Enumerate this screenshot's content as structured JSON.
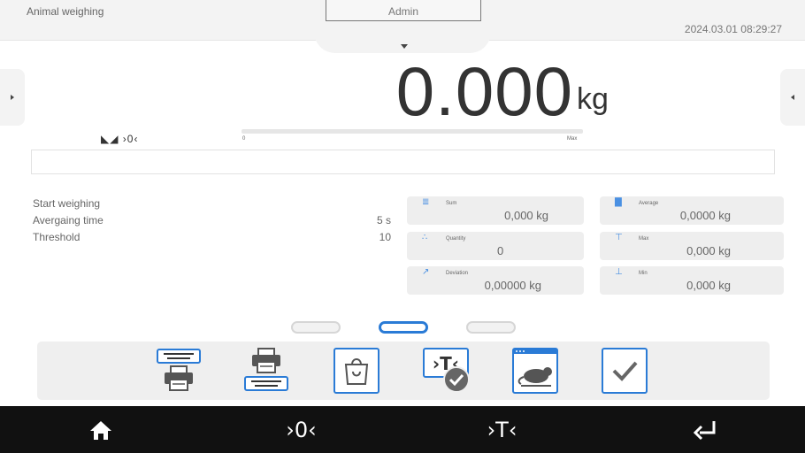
{
  "header": {
    "app_title": "Animal weighing",
    "user": "Admin",
    "datetime": "2024.03.01 08:29:27"
  },
  "reading": {
    "value": "0.000",
    "unit": "kg",
    "status_icons": "◣◢ ›0‹",
    "bargraph_min": "0",
    "bargraph_max": "Max",
    "bargraph_fill_fraction": 0
  },
  "info_line": "",
  "settings": [
    {
      "label": "Start weighing",
      "value": ""
    },
    {
      "label": "Avergaing time",
      "value": "5 s"
    },
    {
      "label": "Threshold",
      "value": "10"
    }
  ],
  "stats": {
    "sum": {
      "label": "Sum",
      "value": "0,000 kg",
      "icon": "sum-icon"
    },
    "average": {
      "label": "Average",
      "value": "0,0000 kg",
      "icon": "average-icon"
    },
    "quantity": {
      "label": "Quantity",
      "value": "0",
      "icon": "quantity-icon"
    },
    "max": {
      "label": "Max",
      "value": "0,000 kg",
      "icon": "max-icon"
    },
    "deviation": {
      "label": "Deviation",
      "value": "0,00000 kg",
      "icon": "deviation-icon"
    },
    "min": {
      "label": "Min",
      "value": "0,000 kg",
      "icon": "min-icon"
    }
  },
  "pager": {
    "pages": 3,
    "active": 2
  },
  "toolbar": [
    "print-header-icon",
    "print-footer-icon",
    "product-bag-icon",
    "tare-confirm-icon",
    "animal-icon",
    "confirm-icon"
  ],
  "navbar": {
    "home": "home-icon",
    "zero": "›0‹",
    "tare": "›T‹",
    "enter": "enter-icon"
  },
  "colors": {
    "accent": "#2a7bd6",
    "background": "#ffffff",
    "panel": "#efefef",
    "navbar": "#111111"
  }
}
